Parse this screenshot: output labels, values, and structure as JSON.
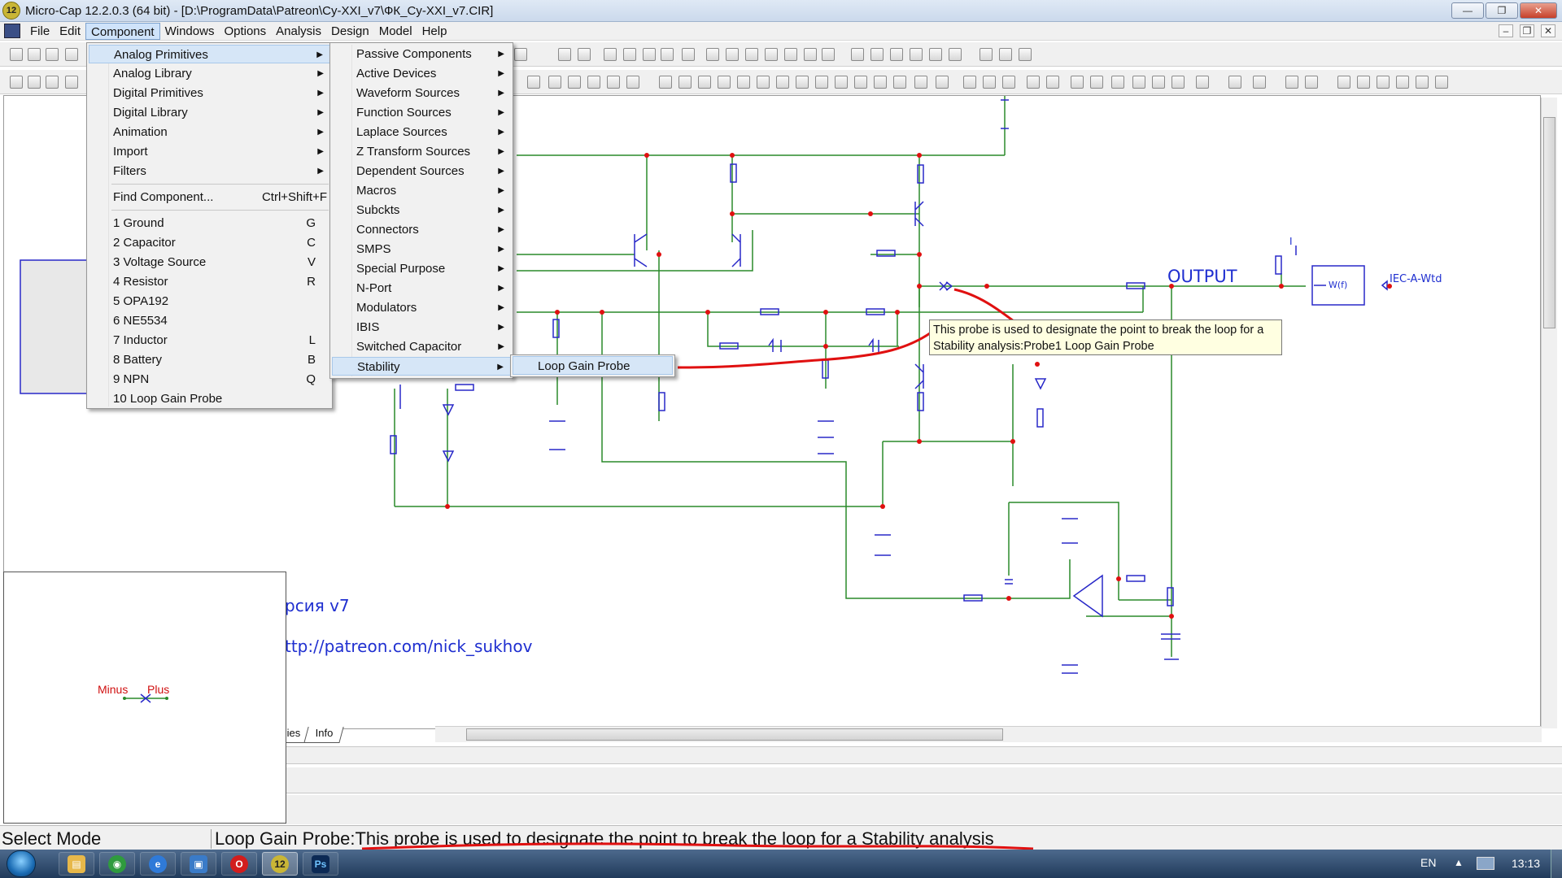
{
  "window": {
    "title": "Micro-Cap 12.2.0.3 (64 bit) - [D:\\ProgramData\\Patreon\\Cy-XXI_v7\\ФК_Cy-XXI_v7.CIR]",
    "app_icon": "12",
    "minimize": "—",
    "maximize": "❐",
    "close": "✕"
  },
  "menubar": {
    "items": [
      "File",
      "Edit",
      "Component",
      "Windows",
      "Options",
      "Analysis",
      "Design",
      "Model",
      "Help"
    ],
    "mdi": [
      "–",
      "❐",
      "✕"
    ]
  },
  "component_menu": {
    "items": [
      {
        "label": "Analog Primitives",
        "submenu": true
      },
      {
        "label": "Analog Library",
        "submenu": true
      },
      {
        "label": "Digital Primitives",
        "submenu": true
      },
      {
        "label": "Digital Library",
        "submenu": true
      },
      {
        "label": "Animation",
        "submenu": true
      },
      {
        "label": "Import",
        "submenu": true
      },
      {
        "label": "Filters",
        "submenu": true
      },
      {
        "label": "Find Component...",
        "shortcut": "Ctrl+Shift+F"
      },
      {
        "label": "1 Ground",
        "shortcut": "G"
      },
      {
        "label": "2 Capacitor",
        "shortcut": "C"
      },
      {
        "label": "3 Voltage Source",
        "shortcut": "V"
      },
      {
        "label": "4 Resistor",
        "shortcut": "R"
      },
      {
        "label": "5 OPA192",
        "shortcut": ""
      },
      {
        "label": "6 NE5534",
        "shortcut": ""
      },
      {
        "label": "7 Inductor",
        "shortcut": "L"
      },
      {
        "label": "8 Battery",
        "shortcut": "B"
      },
      {
        "label": "9 NPN",
        "shortcut": "Q"
      },
      {
        "label": "10 Loop Gain Probe",
        "shortcut": ""
      }
    ]
  },
  "analog_primitives_menu": {
    "items": [
      "Passive Components",
      "Active Devices",
      "Waveform Sources",
      "Function Sources",
      "Laplace Sources",
      "Z Transform Sources",
      "Dependent Sources",
      "Macros",
      "Subckts",
      "Connectors",
      "SMPS",
      "Special Purpose",
      "N-Port",
      "Modulators",
      "IBIS",
      "Switched Capacitor",
      "Stability"
    ]
  },
  "stability_menu": {
    "items": [
      "Loop Gain Probe"
    ]
  },
  "tooltip": {
    "line1": "This probe is used to designate the point to break the loop for a",
    "line2": "Stability analysis:Probe1 Loop Gain Probe"
  },
  "schematic": {
    "output_label": "OUTPUT",
    "weighting_label": "IEC-A-Wtd",
    "filter_block": "W(f)",
    "version_text": "рсия v7",
    "url_text": "ttp://patreon.com/nick_sukhov",
    "battery_mark": "I"
  },
  "tabs": [
    "ies",
    "Info"
  ],
  "preview": {
    "minus": "Minus",
    "plus": "Plus"
  },
  "status": {
    "mode": "Select Mode",
    "message": "Loop Gain Probe:This probe is used to designate the point to break the loop for a Stability analysis"
  },
  "taskbar": {
    "lang": "EN",
    "clock": "13:13",
    "apps": [
      {
        "name": "explorer",
        "glyph": "▤",
        "color": "#e7b84a"
      },
      {
        "name": "chrome",
        "glyph": "◉",
        "color": "#2f9b3e"
      },
      {
        "name": "ie",
        "glyph": "e",
        "color": "#2f7ad8"
      },
      {
        "name": "app-blue",
        "glyph": "▣",
        "color": "#3a7bc8"
      },
      {
        "name": "opera",
        "glyph": "O",
        "color": "#d21d1d"
      },
      {
        "name": "microcap",
        "glyph": "12",
        "color": "#c9b636"
      },
      {
        "name": "photoshop",
        "glyph": "Ps",
        "color": "#0c2a55"
      }
    ]
  },
  "colors": {
    "wire": "#2a8a2a",
    "component": "#2828c8",
    "node": "#e01010",
    "annotation": "#e01010"
  }
}
